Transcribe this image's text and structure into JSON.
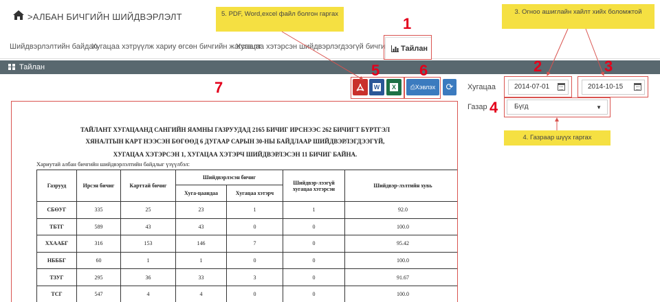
{
  "header": {
    "title": ">АЛБАН БИЧГИЙН ШИЙДВЭРЛЭЛТ"
  },
  "tabs": [
    {
      "label": "Шийдвэрлэлтийн байдал"
    },
    {
      "label": "Хугацаа хэтрүүлж хариу өгсөн бичгийн жагсаалт"
    },
    {
      "label": "Хугацаа хэтэрсэн шийдвэрлэгдээгүй бичгийн жагсаалт"
    },
    {
      "label": "Тайлан"
    }
  ],
  "panel": {
    "title": "Тайлан"
  },
  "toolbar": {
    "print_label": "Хэвлэх",
    "pdf": "PDF",
    "word": "W",
    "excel": "X",
    "refresh": "⟳"
  },
  "filters": {
    "period_label": "Хугацаа",
    "date_from": "2014-07-01",
    "date_to": "2014-10-15",
    "org_label": "Газар",
    "org_value": "Бүгд"
  },
  "annotations": {
    "n1": "1",
    "n2": "2",
    "n3": "3",
    "n4": "4",
    "n5": "5",
    "n6": "6",
    "n7": "7",
    "note3": "3. Огноо ашиглайн хайлт хийх боломжтой",
    "note4": "4. Газраар шүүх гаргах",
    "note5": "5. PDF, Word,excel файл болгон гаргах"
  },
  "report": {
    "title1": "ТАЙЛАНТ ХУГАЦААНД САНГИЙН ЯАМНЫ ГАЗРУУДАД 2165 БИЧИГ ИРСНЭЭС 262 БИЧИГТ БҮРТГЭЛ",
    "title2": "ХЯНАЛТЫН КАРТ НЭЭСЭН БӨГӨӨД 6 ДУГААР САРЫН 30-НЫ БАЙДЛААР ШИЙДВЭРЛЭГДЭЭГҮЙ,",
    "title3": "ХУГАЦАА ХЭТЭРСЭН 1, ХУГАЦАА ХЭТЭРЧ ШИЙДВЭРЛЭСЭН 11 БИЧИГ БАЙНА.",
    "note": "Хариутай албан бичгийн шийдвэрлэлтийн байдлыг үзүүлбэл:",
    "headers": {
      "org": "Газрууд",
      "received": "Ирсэн бичиг",
      "card": "Карттай бичиг",
      "resolved": "Шийдвэрлэсэн бичиг",
      "in_time": "Хуга-цаандаа",
      "overdue": "Хугацаа хэтэрч",
      "unresolved": "Шийдвэр-лээгүй хугацаа хэтэрсэн",
      "rate": "Шийдвэр-лэлтийн хувь"
    },
    "rows": [
      [
        "СБӨУГ",
        "335",
        "25",
        "23",
        "1",
        "1",
        "92.0"
      ],
      [
        "ТБТГ",
        "589",
        "43",
        "43",
        "0",
        "0",
        "100.0"
      ],
      [
        "ХХААБГ",
        "316",
        "153",
        "146",
        "7",
        "0",
        "95.42"
      ],
      [
        "НБББГ",
        "60",
        "1",
        "1",
        "0",
        "0",
        "100.0"
      ],
      [
        "ТЗУГ",
        "295",
        "36",
        "33",
        "3",
        "0",
        "91.67"
      ],
      [
        "ТСГ",
        "547",
        "4",
        "4",
        "0",
        "0",
        "100.0"
      ]
    ]
  }
}
